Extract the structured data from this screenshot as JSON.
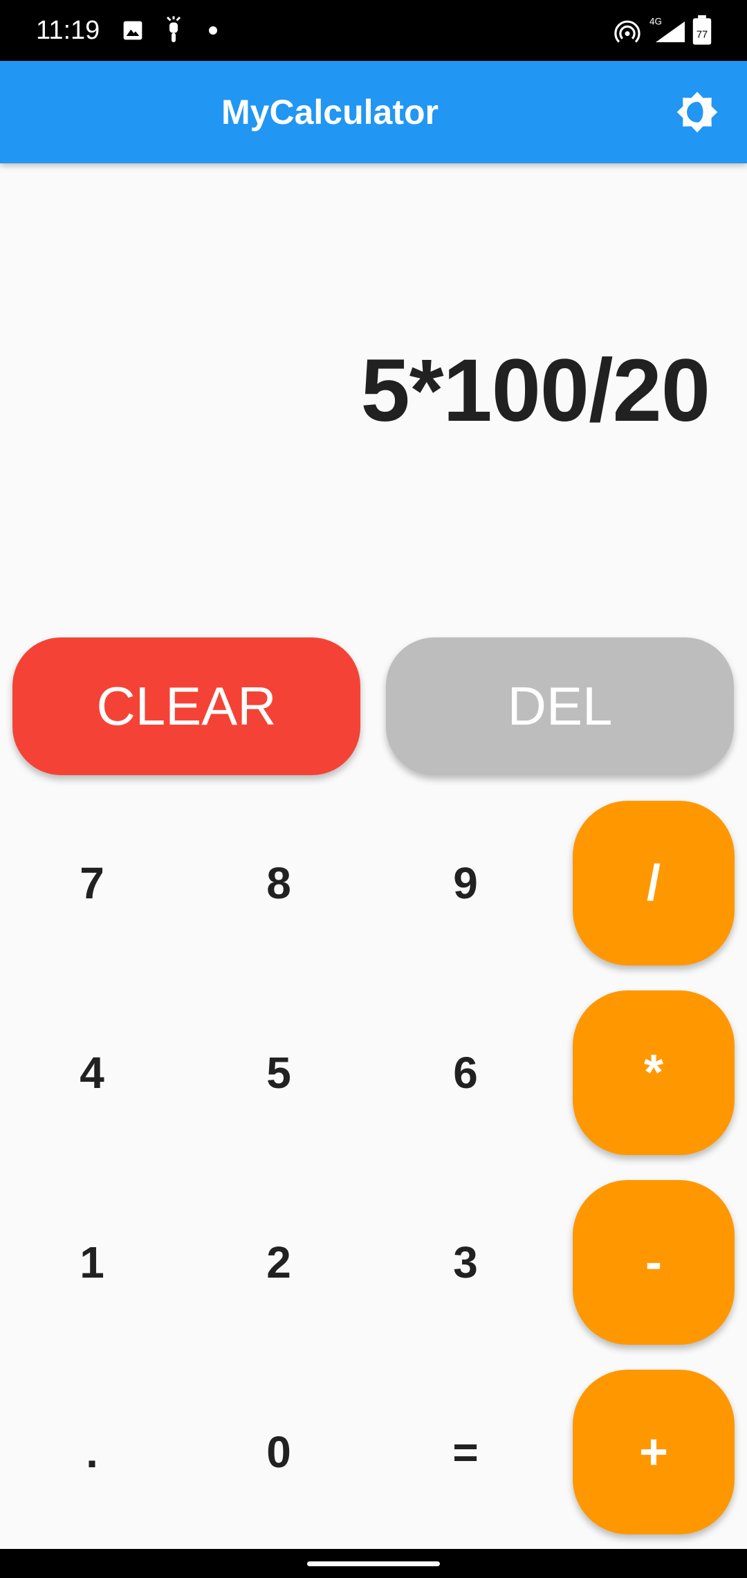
{
  "status_bar": {
    "time": "11:19",
    "network": "4G",
    "battery": "77"
  },
  "app_bar": {
    "title": "MyCalculator"
  },
  "display": {
    "expression": "5*100/20"
  },
  "actions": {
    "clear_label": "CLEAR",
    "del_label": "DEL"
  },
  "keypad": {
    "rows": [
      [
        "7",
        "8",
        "9"
      ],
      [
        "4",
        "5",
        "6"
      ],
      [
        "1",
        "2",
        "3"
      ],
      [
        ".",
        "0",
        "="
      ]
    ],
    "operators": [
      "/",
      "*",
      "-",
      "+"
    ]
  },
  "colors": {
    "app_bar": "#2196F3",
    "clear": "#F44336",
    "del": "#BDBDBD",
    "operator": "#FF9800",
    "background": "#FAFAFA",
    "text": "#212121"
  },
  "icons": {
    "theme_toggle": "brightness-icon",
    "status": [
      "image-icon",
      "scooter-icon",
      "dot-icon",
      "hotspot-icon",
      "signal-icon",
      "battery-icon"
    ]
  }
}
